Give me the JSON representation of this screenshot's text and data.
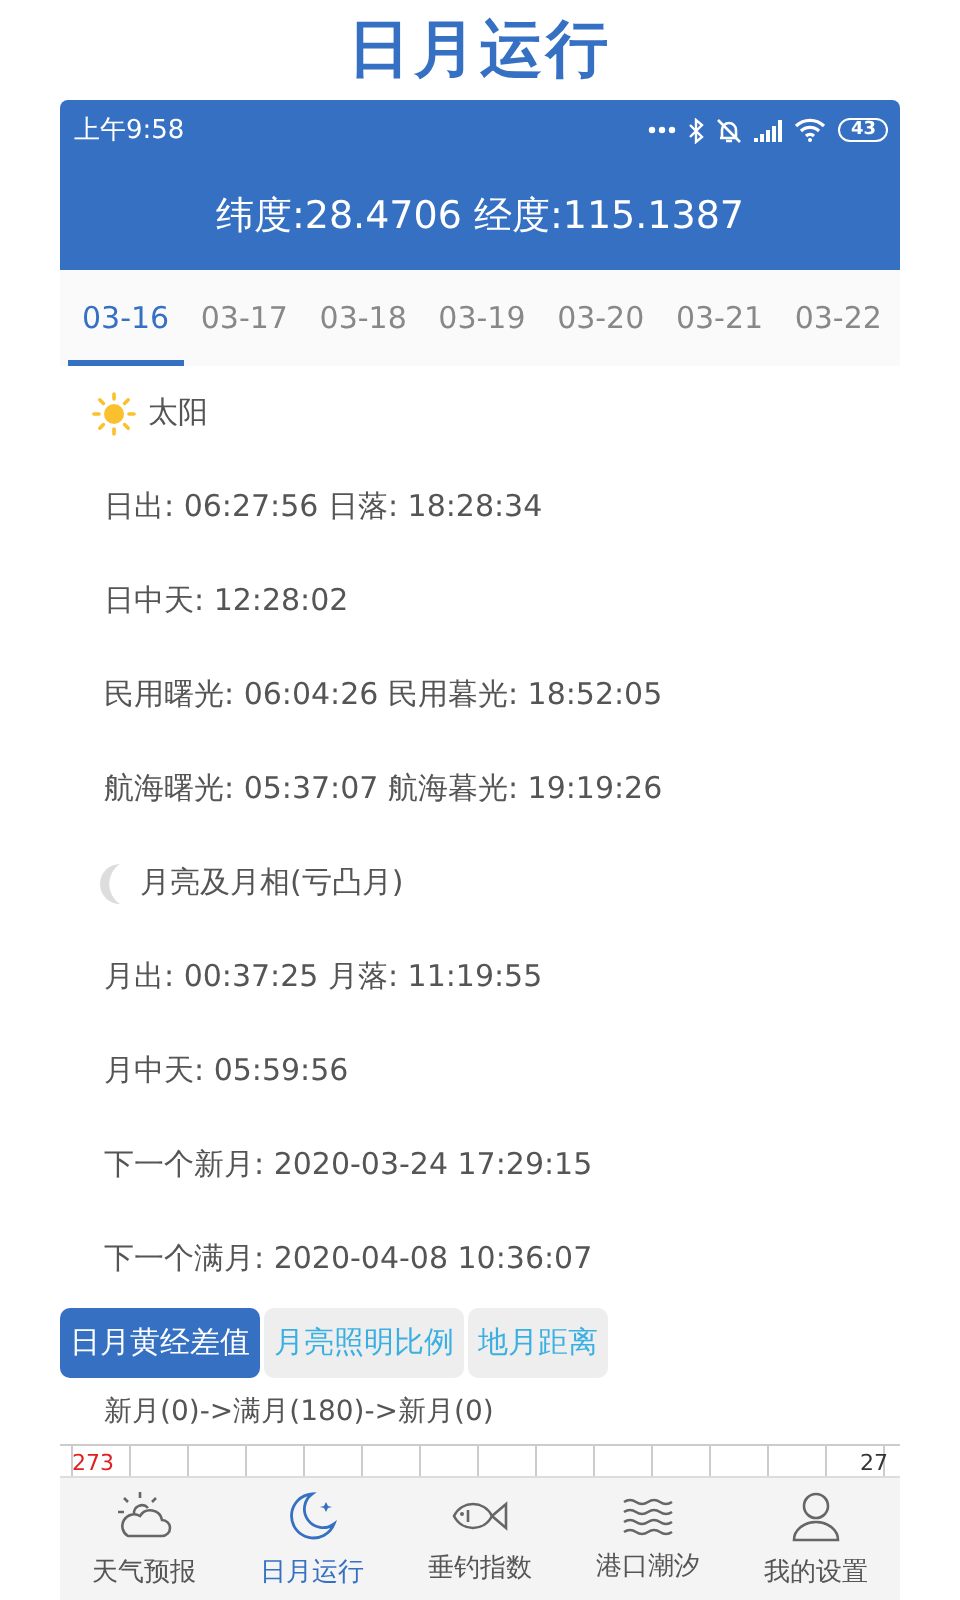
{
  "app_title": "日月运行",
  "status_bar": {
    "time": "上午9:58",
    "battery": "43"
  },
  "header": {
    "coordinates": "纬度:28.4706 经度:115.1387"
  },
  "date_tabs": [
    {
      "label": "03-16",
      "selected": true
    },
    {
      "label": "03-17",
      "selected": false
    },
    {
      "label": "03-18",
      "selected": false
    },
    {
      "label": "03-19",
      "selected": false
    },
    {
      "label": "03-20",
      "selected": false
    },
    {
      "label": "03-21",
      "selected": false
    },
    {
      "label": "03-22",
      "selected": false
    }
  ],
  "sections": [
    {
      "kind": "sun",
      "title": "太阳",
      "lines": [
        "日出: 06:27:56 日落: 18:28:34",
        "日中天: 12:28:02",
        "民用曙光: 06:04:26 民用暮光: 18:52:05",
        "航海曙光: 05:37:07 航海暮光: 19:19:26"
      ]
    },
    {
      "kind": "moon",
      "title": "月亮及月相(亏凸月)",
      "lines": [
        "月出: 00:37:25 月落: 11:19:55",
        "月中天: 05:59:56",
        "下一个新月: 2020-03-24 17:29:15",
        "下一个满月: 2020-04-08 10:36:07"
      ]
    }
  ],
  "chart_tabs": [
    {
      "label": "日月黄经差值",
      "selected": true
    },
    {
      "label": "月亮照明比例",
      "selected": false
    },
    {
      "label": "地月距离",
      "selected": false
    }
  ],
  "chart": {
    "caption": "新月(0)->满月(180)->新月(0)",
    "left_label": "273",
    "right_label": "27"
  },
  "bottom_nav": [
    {
      "kind": "weather",
      "label": "天气预报",
      "selected": false
    },
    {
      "kind": "moon",
      "label": "日月运行",
      "selected": true
    },
    {
      "kind": "fish",
      "label": "垂钓指数",
      "selected": false
    },
    {
      "kind": "waves",
      "label": "港口潮汐",
      "selected": false
    },
    {
      "kind": "person",
      "label": "我的设置",
      "selected": false
    }
  ]
}
